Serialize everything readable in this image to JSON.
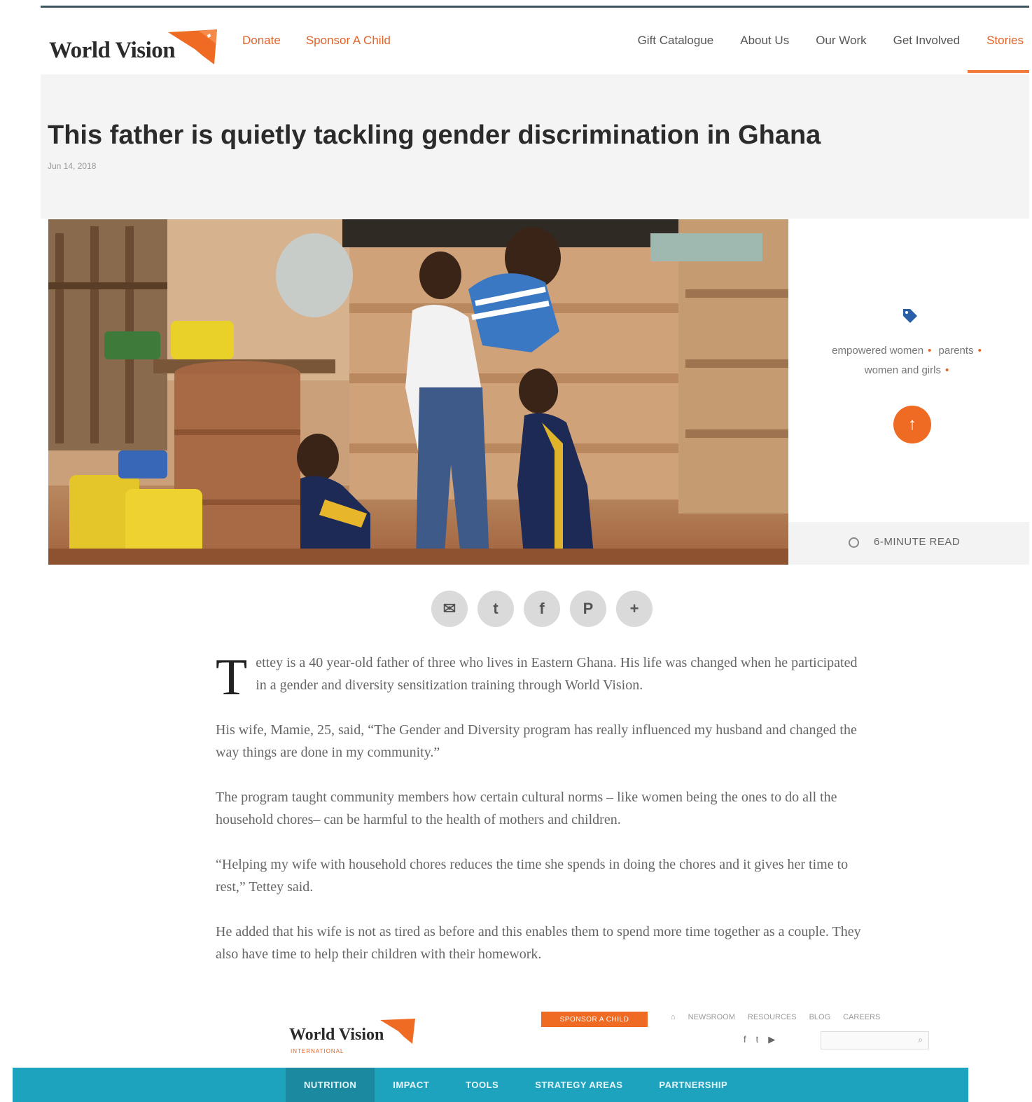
{
  "header": {
    "logo_text": "World Vision",
    "nav_left": [
      "Donate",
      "Sponsor A Child"
    ],
    "nav_right": [
      "Gift Catalogue",
      "About Us",
      "Our Work",
      "Get Involved",
      "Stories"
    ],
    "active_nav": "Stories"
  },
  "article": {
    "title": "This father is quietly tackling gender discrimination in Ghana",
    "date": "Jun 14, 2018",
    "dropcap": "T",
    "paragraphs": [
      "ettey is a 40 year-old father of three who lives in Eastern Ghana. His life was changed when he participated in a gender and diversity sensitization training through World Vision.",
      "His wife, Mamie, 25, said, “The Gender and Diversity program has really influenced my husband and changed the way things are done in my community.”",
      "The program taught community members how certain cultural norms – like women being the ones to do all the household chores– can be harmful to the health of mothers and children.",
      "“Helping my wife with household chores reduces the time she spends in doing the chores and it gives her time to rest,” Tettey said.",
      "He added that his wife is not as tired as before and this enables them to spend more time together as a couple. They also have time to help their children with their homework."
    ]
  },
  "side_panel": {
    "tags": [
      "empowered women",
      "parents",
      "women and girls"
    ],
    "read_time": "6-MINUTE READ",
    "icons": [
      "tag-icon",
      "arrow-up-icon",
      "clock-icon"
    ]
  },
  "share": {
    "icons": [
      "email-icon",
      "twitter-icon",
      "facebook-icon",
      "pinterest-icon",
      "plus-icon"
    ],
    "glyphs": [
      "✉",
      "t",
      "f",
      "P",
      "+"
    ]
  },
  "footer": {
    "logo_text": "World Vision",
    "logo_sub": "INTERNATIONAL",
    "sponsor_label": "SPONSOR A CHILD",
    "links": [
      "NEWSROOM",
      "RESOURCES",
      "BLOG",
      "CAREERS"
    ],
    "social": [
      "f",
      "t",
      "▶"
    ],
    "nav": [
      "NUTRITION",
      "IMPACT",
      "TOOLS",
      "STRATEGY AREAS",
      "PARTNERSHIP"
    ],
    "active_nav": "NUTRITION"
  },
  "colors": {
    "brand_orange": "#ef6b23",
    "footer_teal": "#1ea3be",
    "title_band": "#f4f4f4"
  }
}
